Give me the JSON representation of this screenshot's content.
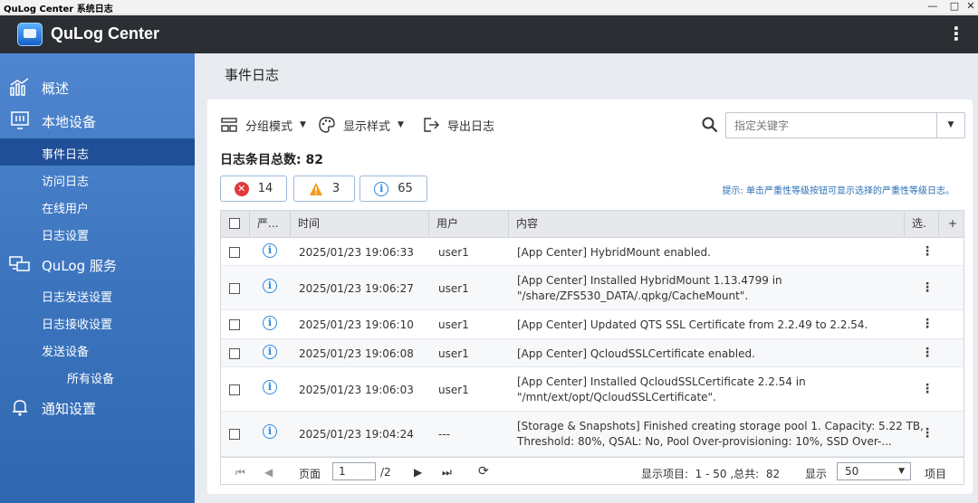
{
  "window": {
    "title": "QuLog Center 系统日志"
  },
  "app": {
    "name": "QuLog Center"
  },
  "sidebar": {
    "overview": "概述",
    "local": "本地设备",
    "local_items": [
      "事件日志",
      "访问日志",
      "在线用户",
      "日志设置"
    ],
    "service": "QuLog 服务",
    "service_items": [
      "日志发送设置",
      "日志接收设置",
      "发送设备"
    ],
    "service_sub": "所有设备",
    "notify": "通知设置"
  },
  "page": {
    "title": "事件日志"
  },
  "toolbar": {
    "group": "分组模式",
    "display": "显示样式",
    "export": "导出日志",
    "search_placeholder": "指定关键字"
  },
  "summary": {
    "label": "日志条目总数: 82"
  },
  "severity": {
    "error": "14",
    "warning": "3",
    "info": "65"
  },
  "hint": "提示: 单击严重性等级按钮可显示选择的严重性等级日志。",
  "table": {
    "columns": [
      "严...",
      "时间",
      "用户",
      "内容",
      "选.",
      "+"
    ],
    "rows": [
      {
        "time": "2025/01/23 19:06:33",
        "user": "user1",
        "content": [
          "[App Center] HybridMount enabled."
        ]
      },
      {
        "time": "2025/01/23 19:06:27",
        "user": "user1",
        "content": [
          "[App Center] Installed HybridMount 1.13.4799 in",
          "\"/share/ZFS530_DATA/.qpkg/CacheMount\"."
        ]
      },
      {
        "time": "2025/01/23 19:06:10",
        "user": "user1",
        "content": [
          "[App Center] Updated QTS SSL Certificate from 2.2.49 to 2.2.54."
        ]
      },
      {
        "time": "2025/01/23 19:06:08",
        "user": "user1",
        "content": [
          "[App Center] QcloudSSLCertificate enabled."
        ]
      },
      {
        "time": "2025/01/23 19:06:03",
        "user": "user1",
        "content": [
          "[App Center] Installed QcloudSSLCertificate 2.2.54 in",
          "\"/mnt/ext/opt/QcloudSSLCertificate\"."
        ]
      },
      {
        "time": "2025/01/23 19:04:24",
        "user": "---",
        "content": [
          "[Storage & Snapshots] Finished creating storage pool 1. Capacity: 5.22 TB,",
          "Threshold: 80%, QSAL: No, Pool Over-provisioning: 10%, SSD Over-..."
        ]
      }
    ]
  },
  "pager": {
    "page_label": "页面",
    "page_value": "1",
    "page_total": "/2",
    "display_items": "显示项目:  1 - 50 ,总共:  82",
    "display": "显示",
    "per_page": "50",
    "items": "项目"
  }
}
